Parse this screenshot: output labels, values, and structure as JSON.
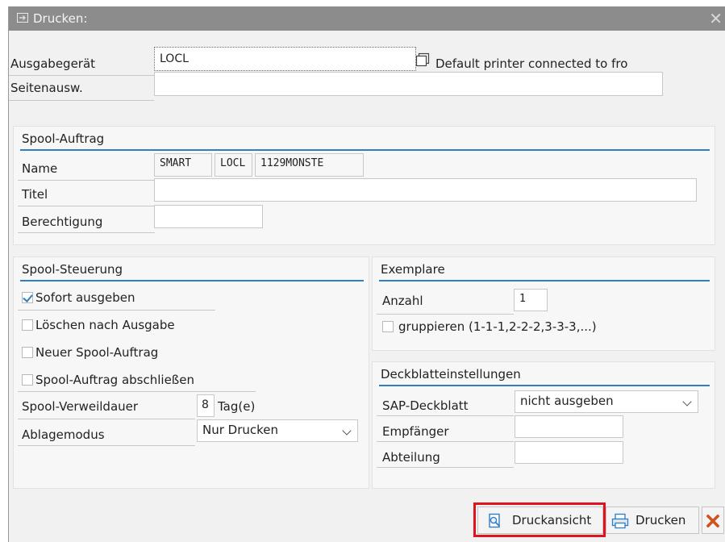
{
  "window": {
    "title": "Drucken:",
    "close_glyph": "✕"
  },
  "output": {
    "device_label": "Ausgabegerät",
    "device_value": "LOCL",
    "device_description": "Default printer connected to fro",
    "pages_label": "Seitenausw.",
    "pages_value": ""
  },
  "spool_job": {
    "heading": "Spool-Auftrag",
    "name_label": "Name",
    "name_part1": "SMART",
    "name_part2": "LOCL",
    "name_part3": "1129MONSTE",
    "title_label": "Titel",
    "title_value": "",
    "auth_label": "Berechtigung",
    "auth_value": ""
  },
  "spool_control": {
    "heading": "Spool-Steuerung",
    "checkboxes": [
      {
        "label": "Sofort ausgeben",
        "checked": true
      },
      {
        "label": "Löschen nach Ausgabe",
        "checked": false
      },
      {
        "label": "Neuer Spool-Auftrag",
        "checked": false
      },
      {
        "label": "Spool-Auftrag abschließen",
        "checked": false
      }
    ],
    "retention_label": "Spool-Verweildauer",
    "retention_value": "8",
    "retention_unit": "Tag(e)",
    "storage_label": "Ablagemodus",
    "storage_value": "Nur Drucken"
  },
  "copies": {
    "heading": "Exemplare",
    "count_label": "Anzahl",
    "count_value": "1",
    "group_label": "gruppieren (1-1-1,2-2-2,3-3-3,...)",
    "group_checked": false
  },
  "cover": {
    "heading": "Deckblatteinstellungen",
    "sap_cover_label": "SAP-Deckblatt",
    "sap_cover_value": "nicht ausgeben",
    "recipient_label": "Empfänger",
    "recipient_value": "",
    "department_label": "Abteilung",
    "department_value": ""
  },
  "buttons": {
    "preview": "Druckansicht",
    "print": "Drucken"
  },
  "colors": {
    "accent": "#2f7ec3",
    "highlight": "#e0141e",
    "cancel": "#d2541c",
    "titlebar": "#8c8c8c"
  }
}
